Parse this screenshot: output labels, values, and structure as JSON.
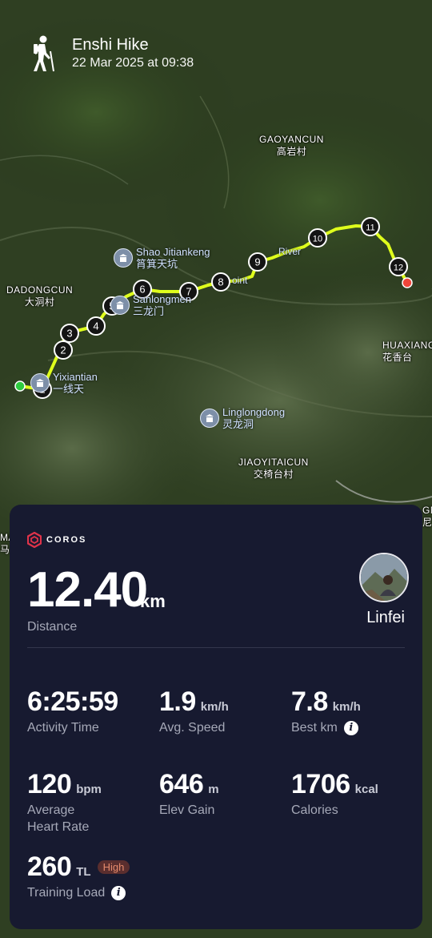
{
  "header": {
    "activity_icon": "hiker-icon",
    "title": "Enshi Hike",
    "date": "22 Mar 2025 at 09:38"
  },
  "map": {
    "labels": {
      "gaoyancun_en": "GAOYANCUN",
      "gaoyancun_cn": "高岩村",
      "dadongcun_en": "DADONGCUN",
      "dadongcun_cn": "大洞村",
      "huaxiang_en": "HUAXIANG",
      "huaxiang_cn": "花香台",
      "jiaoyitaicun_en": "JIAOYITAICUN",
      "jiaoyitaicun_cn": "交椅台村",
      "edge_ma": "MA",
      "edge_ma_cn": "马",
      "edge_gn": "GN",
      "edge_gn_cn": "尼"
    },
    "pois": {
      "shao_en": "Shao Jitiankeng",
      "shao_cn": "筲箕天坑",
      "sanlong_en": "Sanlongmen",
      "sanlong_cn": "三龙门",
      "yixian_en": "Yixiantian",
      "yixian_cn": "一线天",
      "linglong_en": "Linglongdong",
      "linglong_cn": "灵龙洞",
      "river": "River",
      "point": "oint"
    },
    "markers": [
      "1",
      "2",
      "3",
      "4",
      "5",
      "6",
      "7",
      "8",
      "9",
      "10",
      "11",
      "12"
    ],
    "colors": {
      "route": "#dfff1c",
      "start": "#2ecc40",
      "end": "#f0453a"
    }
  },
  "card": {
    "brand": "COROS",
    "distance": {
      "value": "12.40",
      "unit": "km",
      "label": "Distance"
    },
    "user": {
      "name": "Linfei"
    },
    "metrics": {
      "activity_time": {
        "value": "6:25:59",
        "label": "Activity Time"
      },
      "avg_speed": {
        "value": "1.9",
        "unit": "km/h",
        "label": "Avg. Speed"
      },
      "best_km": {
        "value": "7.8",
        "unit": "km/h",
        "label": "Best km"
      },
      "heart_rate": {
        "value": "120",
        "unit": "bpm",
        "label": "Average Heart Rate"
      },
      "elev_gain": {
        "value": "646",
        "unit": "m",
        "label": "Elev Gain"
      },
      "calories": {
        "value": "1706",
        "unit": "kcal",
        "label": "Calories"
      },
      "training_load": {
        "value": "260",
        "unit": "TL",
        "badge": "High",
        "label": "Training Load"
      }
    }
  }
}
